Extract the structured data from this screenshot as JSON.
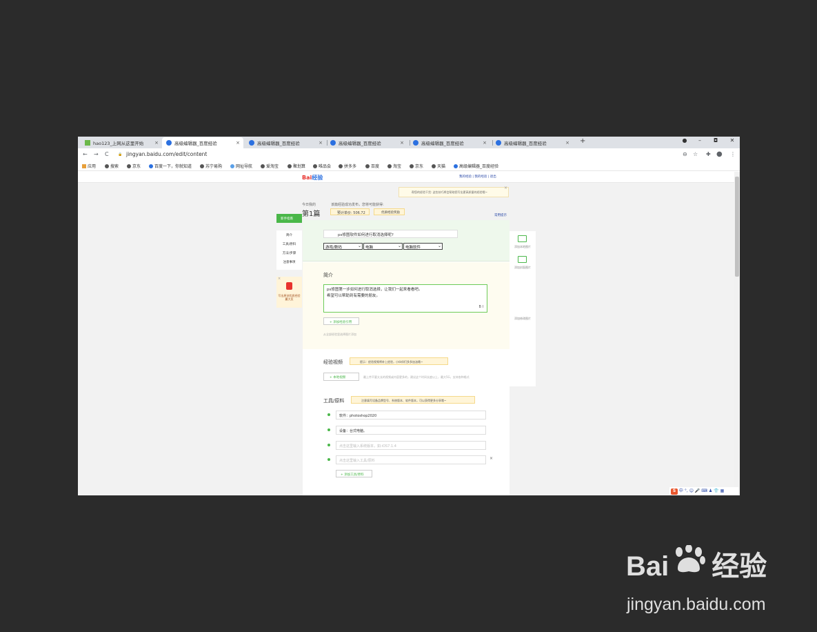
{
  "tabs": [
    {
      "label": "hao123_上网从这里开始",
      "active": false
    },
    {
      "label": "高级编辑器_百度经验",
      "active": true
    },
    {
      "label": "高级编辑器_百度经验",
      "active": false
    },
    {
      "label": "高级编辑器_百度经验",
      "active": false
    },
    {
      "label": "高级编辑器_百度经验",
      "active": false
    },
    {
      "label": "高级编辑器_百度经验",
      "active": false
    }
  ],
  "tab_close": "×",
  "new_tab": "+",
  "window": {
    "minimize": "–",
    "maximize": "◘",
    "close": "✕",
    "record": "●"
  },
  "toolbar": {
    "back": "←",
    "forward": "→",
    "reload": "C",
    "lock": "🔒",
    "url": "jingyan.baidu.com/edit/content",
    "zoom": "⊖",
    "star": "☆",
    "ext": "✚",
    "profile": "●",
    "menu": "⋮"
  },
  "bookmarks": [
    "应用",
    "搜索",
    "京东",
    "百度一下，你就知道",
    "苏宁易购",
    "网址导航",
    "爱淘宝",
    "聚划算",
    "唯品会",
    "拼多多",
    "百度",
    "淘宝",
    "京东",
    "天猫",
    "高级编辑器_百度经验"
  ],
  "page": {
    "logo_a": "Bai",
    "logo_b": "经验",
    "toplinks": "我的经验 | 我的经验 | 退出",
    "notice": "帮您的经验干货: 这些技巧将会帮助您写出更高质量的经验哦~",
    "notice_close": "×",
    "today_label": "今日我的",
    "today_count": "第1篇",
    "publish_tip": "该篇经验成功发布，您将可能获得:",
    "chip1": "预计单价: 506.72",
    "chip2": "优质经验奖励",
    "help": "常用提示",
    "new_btn": "新手指南",
    "nav": [
      "简介",
      "工具/原料",
      "方法/步骤",
      "注意事项"
    ],
    "promo_close": "×",
    "promo_text": "写出原创优质经验赢大奖",
    "title_value": "ps修图软件如何进行取消选择呢?",
    "selects": [
      "游戏/数码",
      "电脑",
      "电脑软件"
    ],
    "intro_title": "简介",
    "intro_line1": "ps修图第一步如何进行取消选择，让我们一起来看看吧。",
    "intro_line2": "希望可以帮助到有需要的朋友。",
    "intro_fmt": "B I",
    "add_ref": "+ 添加经验引用",
    "hint": "从全部经验里选择图片添加",
    "video_title": "经验视频",
    "video_tip": "提示：经验视频将补上经验，小伙伴们多多加油哦~",
    "video_btn": "+ 本地视频",
    "video_hint": "最上传不要太长的视频或内容更多的，建议这个时间长度以上，最大5G，支持各种格式",
    "tools_title": "工具/原料",
    "tools_tip": "注意填写设备品牌型号、系统版本、软件版本，可以获得更多分享哦~",
    "tool_items": [
      {
        "value": "软件：photoshop2020",
        "placeholder": false
      },
      {
        "value": "设备：台式电脑。",
        "placeholder": false
      },
      {
        "value": "点击这里输入系统版本，如:iOS7.1.4",
        "placeholder": true
      },
      {
        "value": "点击这里输入工具/原料",
        "placeholder": true
      }
    ],
    "remove": "×",
    "add_tool": "+ 添加工具/原料",
    "right_items": [
      "添加本地图片",
      "添加封面图片",
      "添加修改图片"
    ]
  },
  "ime": [
    "S",
    "中",
    "°,",
    "☺",
    "🎤",
    "⌨",
    "♟",
    "👕",
    "▦"
  ],
  "watermark": {
    "brand_a": "Bai",
    "brand_b": "经验",
    "url": "jingyan.baidu.com"
  }
}
